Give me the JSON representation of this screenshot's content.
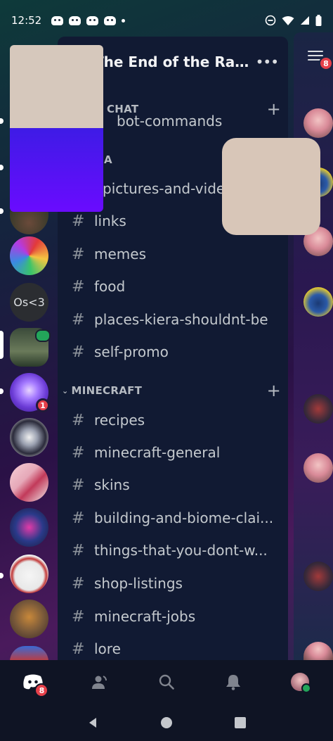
{
  "status_bar": {
    "time": "12:52"
  },
  "guild": {
    "name": "The End of the Rain...",
    "more_label": "•••"
  },
  "server_rail": {
    "text_server_label": "Os<3",
    "mention_badge": "1"
  },
  "categories": [
    {
      "label": "CHAT",
      "visible_prefix": ""
    },
    {
      "label": "A",
      "visible_prefix": ""
    },
    {
      "label": "MINECRAFT"
    }
  ],
  "channels": [
    {
      "name": "bot-commands",
      "partial": true
    },
    {
      "name": "pictures-and-vide"
    },
    {
      "name": "links"
    },
    {
      "name": "memes"
    },
    {
      "name": "food"
    },
    {
      "name": "places-kiera-shouldnt-be"
    },
    {
      "name": "self-promo"
    },
    {
      "name": "recipes"
    },
    {
      "name": "minecraft-general"
    },
    {
      "name": "skins"
    },
    {
      "name": "building-and-biome-clai..."
    },
    {
      "name": "things-that-you-dont-w..."
    },
    {
      "name": "shop-listings"
    },
    {
      "name": "minecraft-jobs"
    },
    {
      "name": "lore"
    }
  ],
  "chat_peek": {
    "menu_badge": "8"
  },
  "bottom_nav": {
    "home_badge": "8"
  },
  "icons": {
    "hash": "#",
    "plus": "+",
    "chevron": "⌄"
  }
}
